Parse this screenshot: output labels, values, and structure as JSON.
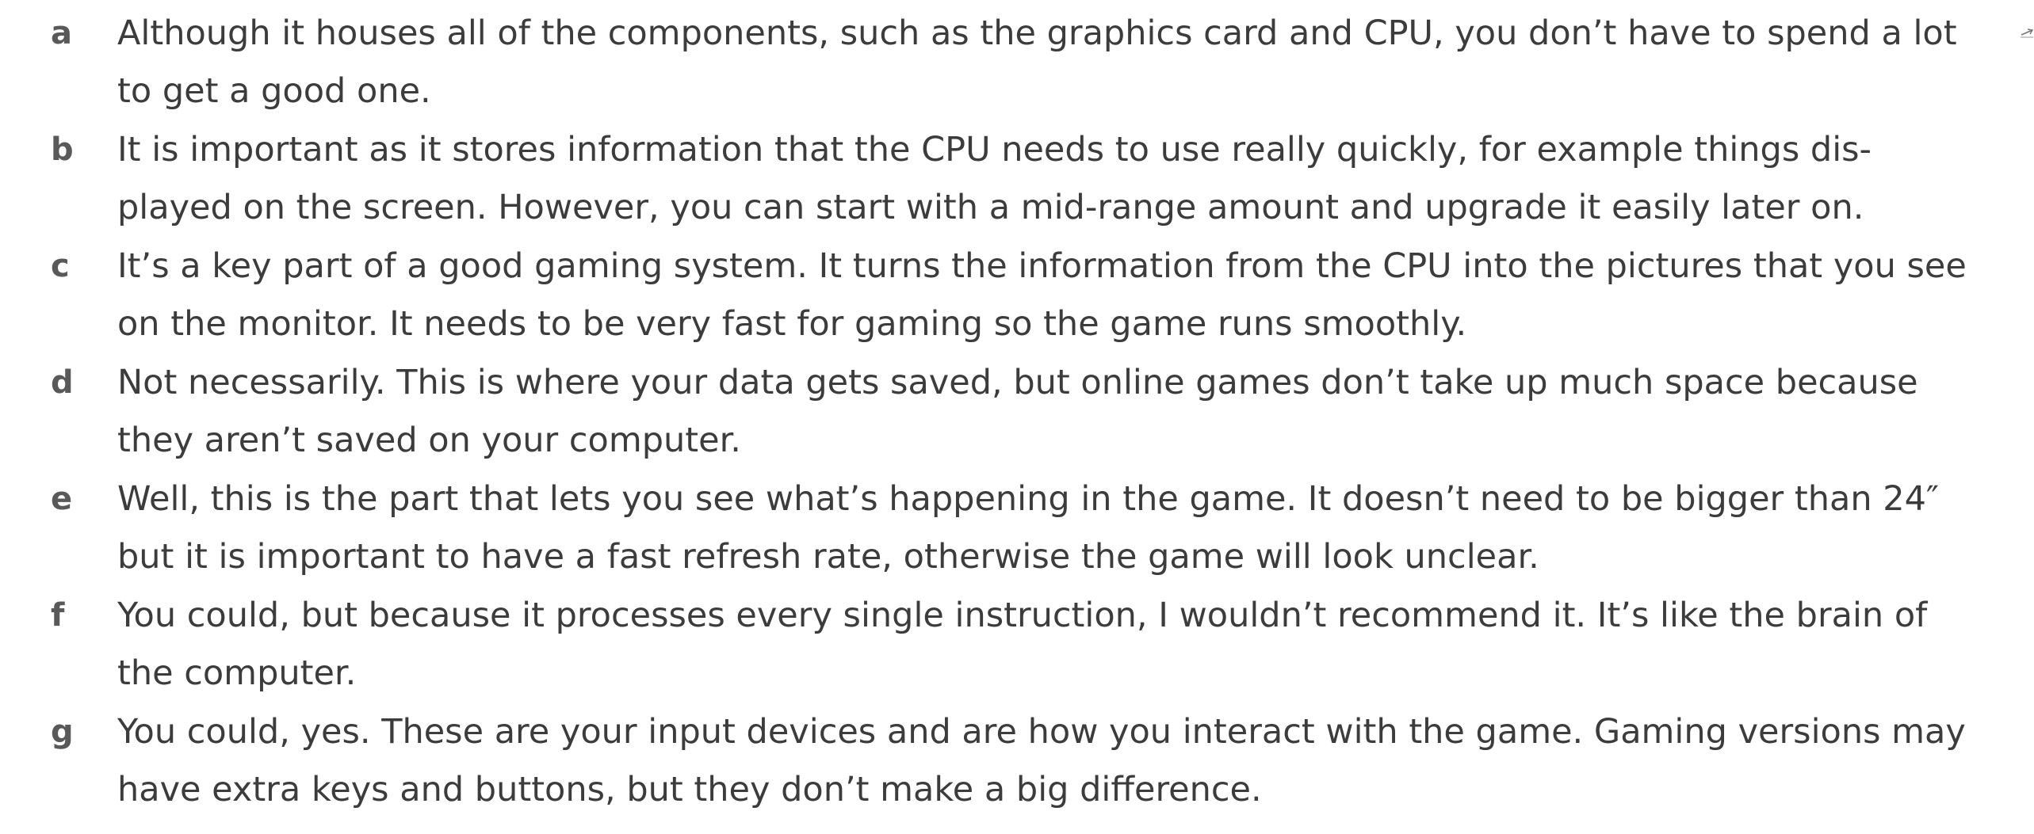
{
  "answers": [
    {
      "letter": "a",
      "line1": "Although it houses all of the components, such as the graphics card and CPU, you don’t have to spend a lot",
      "line2": "to get a good one."
    },
    {
      "letter": "b",
      "line1": "It is important as it stores information that the CPU needs to use really quickly, for example things dis-",
      "line2": "played on the screen. However, you can start with a mid-range amount and upgrade it easily later on."
    },
    {
      "letter": "c",
      "line1": "It’s a key part of a good gaming system. It turns the information from the CPU into the pictures that you see",
      "line2": "on the monitor. It needs to be very fast for gaming so the game runs smoothly."
    },
    {
      "letter": "d",
      "line1": "Not necessarily. This is where your data gets saved, but online games don’t take up much space because",
      "line2": "they aren’t saved on your computer."
    },
    {
      "letter": "e",
      "line1": "Well, this is the part that lets you see what’s happening in the game. It doesn’t need to be bigger than 24″",
      "line2": "but it is important to have a fast refresh rate, otherwise the game will look unclear."
    },
    {
      "letter": "f",
      "line1": "You could, but because it processes every single instruction, I wouldn’t recommend it. It’s like the brain of",
      "line2": "the computer."
    },
    {
      "letter": "g",
      "line1": "You could, yes. These are your input devices and are how you interact with the game. Gaming versions may",
      "line2": "have extra keys and buttons, but they don’t make a big difference."
    }
  ]
}
